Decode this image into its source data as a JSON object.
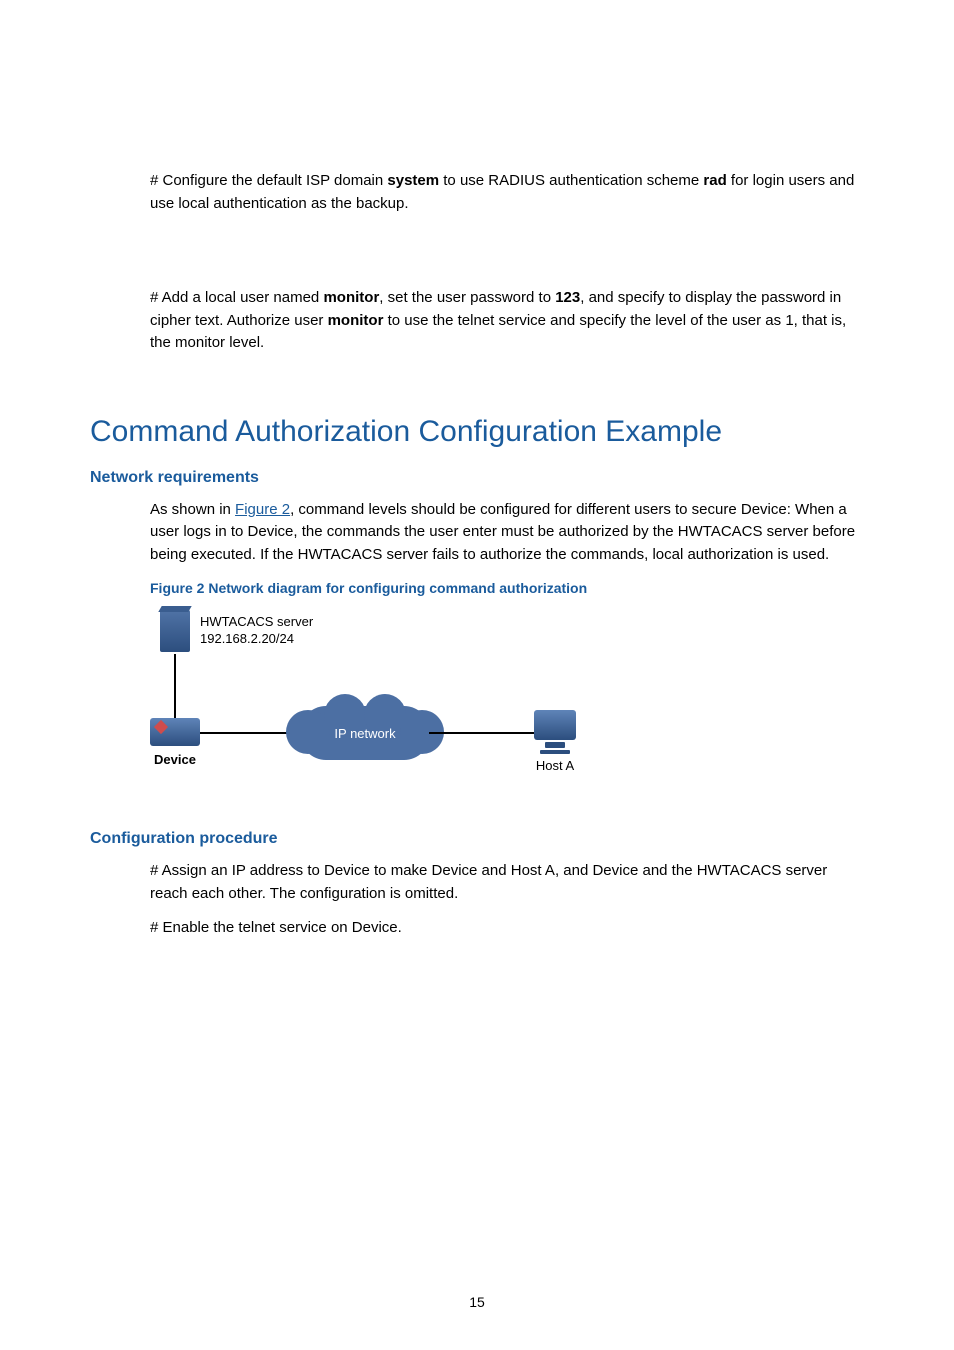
{
  "top": {
    "p1a": "# Configure the default ISP domain ",
    "p1b": "system",
    "p1c": " to use RADIUS authentication scheme ",
    "p1d": "rad",
    "p1e": " for login users and use local authentication as the backup.",
    "p2a": "# Add a local user named ",
    "p2b": "monitor",
    "p2c": ", set the user password to ",
    "p2d": "123",
    "p2e": ", and specify to display the password in cipher text. Authorize user ",
    "p2f": "monitor",
    "p2g": " to use the telnet service and specify the level of the user as 1, that is, the monitor level."
  },
  "h1": "Command Authorization Configuration Example",
  "sec1": {
    "title": "Network requirements",
    "p1a": "As shown in ",
    "p1link": "Figure 2",
    "p1b": ", command levels should be configured for different users to secure Device: When a user logs in to Device, the commands the user enter must be authorized by the HWTACACS server before being executed. If the HWTACACS server fails to authorize the commands, local authorization is used.",
    "figcap": "Figure 2 Network diagram for configuring command authorization"
  },
  "diagram": {
    "server_name": "HWTACACS server",
    "server_addr": "192.168.2.20/24",
    "device": "Device",
    "cloud": "IP network",
    "host": "Host A"
  },
  "sec2": {
    "title": "Configuration procedure",
    "p1": "# Assign an IP address to Device to make Device and Host A, and Device  and the HWTACACS server reach each other. The configuration is omitted.",
    "p2": "# Enable the telnet service on Device."
  },
  "pagenum": "15"
}
